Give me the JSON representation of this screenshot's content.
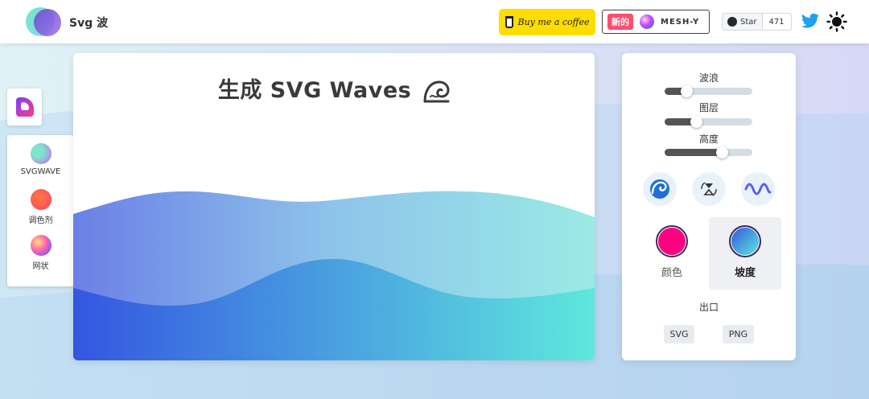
{
  "header": {
    "app_title": "Svg 波",
    "coffee_label": "Buy me a coffee",
    "meshy": {
      "badge": "新的",
      "label": "MESH-Y"
    },
    "github": {
      "star_label": "Star",
      "star_count": "471"
    }
  },
  "sidebar": {
    "items": [
      {
        "label": "SVGWAVE",
        "icon": "svgwave-icon"
      },
      {
        "label": "调色剂",
        "icon": "palette-icon"
      },
      {
        "label": "网状",
        "icon": "mesh-icon"
      }
    ]
  },
  "canvas": {
    "title": "生成 SVG Waves"
  },
  "controls": {
    "sliders": [
      {
        "label": "波浪",
        "value": 0.25
      },
      {
        "label": "图层",
        "value": 0.36
      },
      {
        "label": "高度",
        "value": 0.65
      }
    ],
    "color_options": [
      {
        "label": "颜色",
        "active": false
      },
      {
        "label": "坡度",
        "active": true
      }
    ],
    "export_label": "出口",
    "export_buttons": [
      "SVG",
      "PNG"
    ]
  },
  "colors": {
    "solid_color": "#ff0080",
    "gradient_start": "#3356e0",
    "gradient_end": "#5ee8dc"
  }
}
